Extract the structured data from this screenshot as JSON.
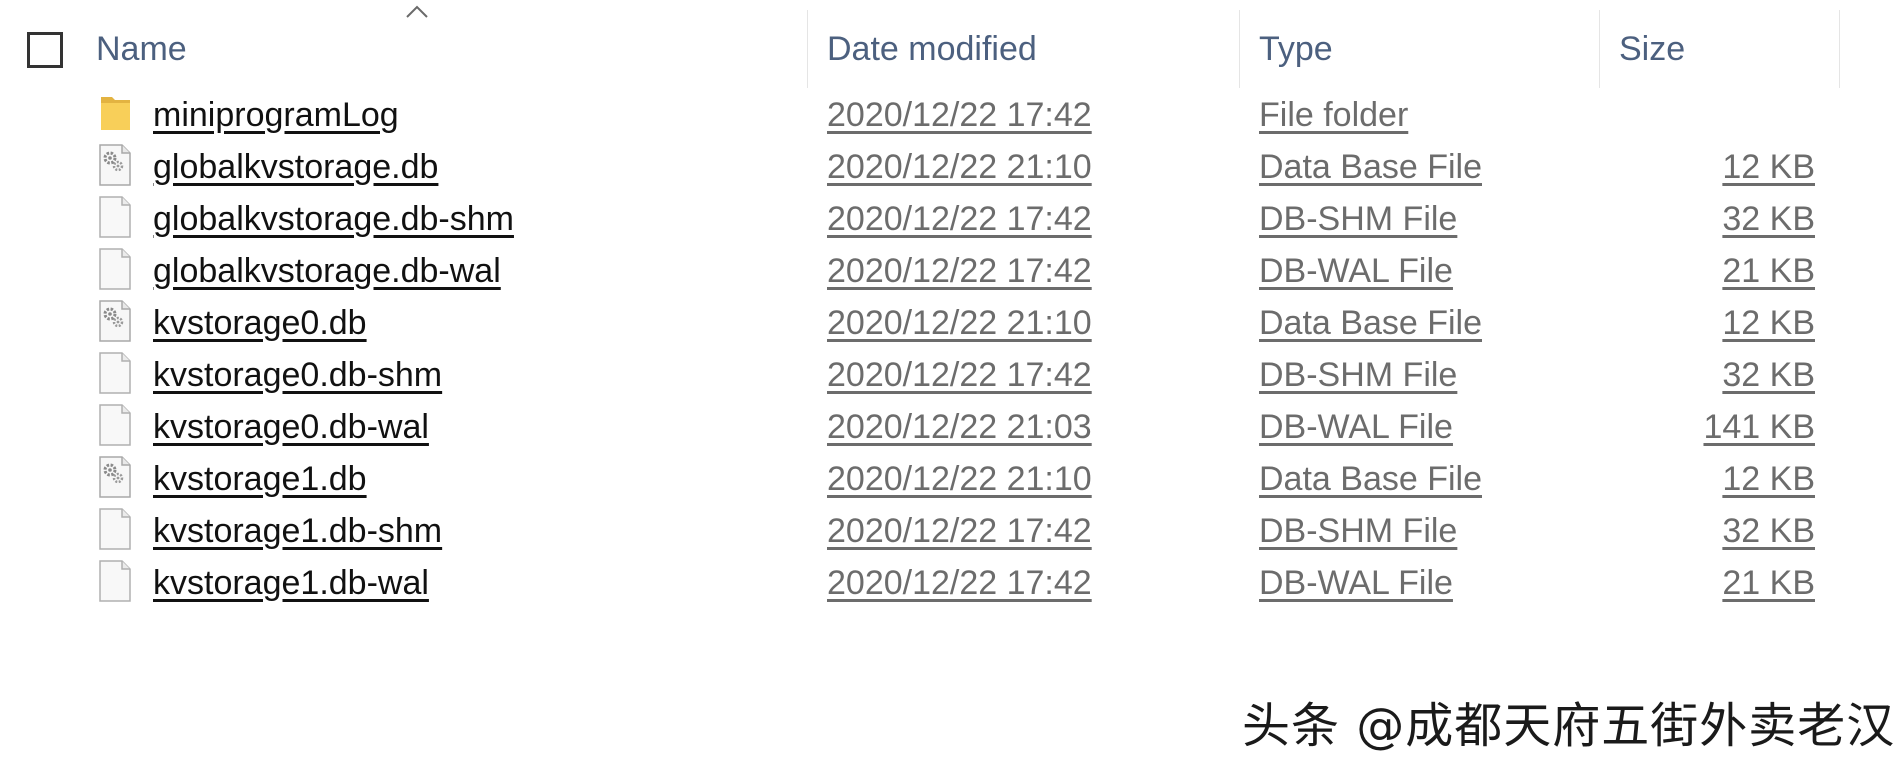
{
  "header": {
    "columns": {
      "name": "Name",
      "date": "Date modified",
      "type": "Type",
      "size": "Size"
    }
  },
  "files": [
    {
      "icon": "folder-icon",
      "name": "miniprogramLog",
      "date": "2020/12/22 17:42",
      "type": "File folder",
      "size": ""
    },
    {
      "icon": "database-file-icon",
      "name": "globalkvstorage.db",
      "date": "2020/12/22 21:10",
      "type": "Data Base File",
      "size": "12 KB"
    },
    {
      "icon": "blank-file-icon",
      "name": "globalkvstorage.db-shm",
      "date": "2020/12/22 17:42",
      "type": "DB-SHM File",
      "size": "32 KB"
    },
    {
      "icon": "blank-file-icon",
      "name": "globalkvstorage.db-wal",
      "date": "2020/12/22 17:42",
      "type": "DB-WAL File",
      "size": "21 KB"
    },
    {
      "icon": "database-file-icon",
      "name": "kvstorage0.db",
      "date": "2020/12/22 21:10",
      "type": "Data Base File",
      "size": "12 KB"
    },
    {
      "icon": "blank-file-icon",
      "name": "kvstorage0.db-shm",
      "date": "2020/12/22 17:42",
      "type": "DB-SHM File",
      "size": "32 KB"
    },
    {
      "icon": "blank-file-icon",
      "name": "kvstorage0.db-wal",
      "date": "2020/12/22 21:03",
      "type": "DB-WAL File",
      "size": "141 KB"
    },
    {
      "icon": "database-file-icon",
      "name": "kvstorage1.db",
      "date": "2020/12/22 21:10",
      "type": "Data Base File",
      "size": "12 KB"
    },
    {
      "icon": "blank-file-icon",
      "name": "kvstorage1.db-shm",
      "date": "2020/12/22 17:42",
      "type": "DB-SHM File",
      "size": "32 KB"
    },
    {
      "icon": "blank-file-icon",
      "name": "kvstorage1.db-wal",
      "date": "2020/12/22 17:42",
      "type": "DB-WAL File",
      "size": "21 KB"
    }
  ],
  "watermark": "头条 @成都天府五街外卖老汉",
  "colors": {
    "header_text": "#4c607f",
    "name_text": "#111111",
    "detail_text": "#6c6c6c",
    "folder": "#f8cf59"
  }
}
